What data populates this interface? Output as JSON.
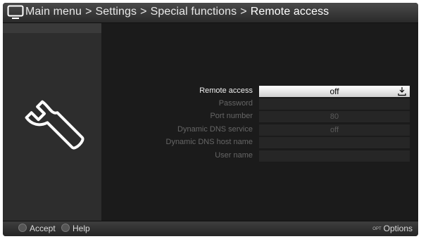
{
  "header": {
    "breadcrumb": [
      "Main menu",
      "Settings",
      "Special functions",
      "Remote access"
    ],
    "separator": ">"
  },
  "icons": {
    "tv": "tv-icon",
    "wrench": "wrench-icon",
    "download": "download-icon",
    "opt": "opt-badge-icon"
  },
  "settings": {
    "rows": [
      {
        "label": "Remote access",
        "value": "off",
        "active": true
      },
      {
        "label": "Password",
        "value": "",
        "active": false
      },
      {
        "label": "Port number",
        "value": "80",
        "active": false
      },
      {
        "label": "Dynamic DNS service",
        "value": "off",
        "active": false
      },
      {
        "label": "Dynamic DNS host name",
        "value": "",
        "active": false
      },
      {
        "label": "User name",
        "value": "",
        "active": false
      }
    ]
  },
  "footer": {
    "accept_label": "Accept",
    "help_label": "Help",
    "opt_badge": "OPT",
    "options_label": "Options"
  }
}
